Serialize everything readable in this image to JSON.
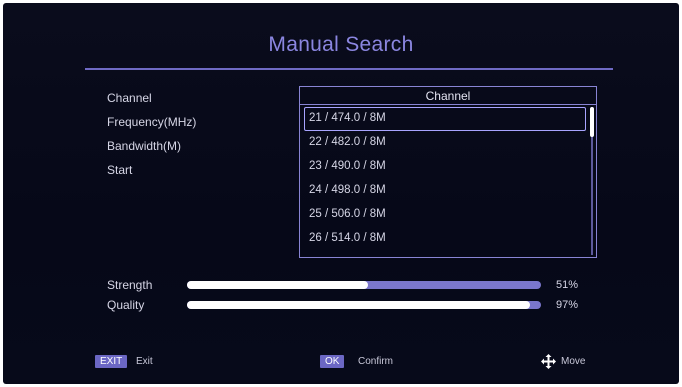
{
  "title": "Manual Search",
  "fields": {
    "channel_label": "Channel",
    "frequency_label": "Frequency(MHz)",
    "bandwidth_label": "Bandwidth(M)",
    "start_label": "Start"
  },
  "channel_list": {
    "header": "Channel",
    "items": [
      "21 / 474.0 / 8M",
      "22 / 482.0 / 8M",
      "23 / 490.0 / 8M",
      "24 / 498.0 / 8M",
      "25 / 506.0 / 8M",
      "26 / 514.0 / 8M"
    ],
    "selected_index": 0
  },
  "signal": {
    "strength_label": "Strength",
    "strength_value": "51%",
    "strength_fraction": 0.51,
    "quality_label": "Quality",
    "quality_value": "97%",
    "quality_fraction": 0.97
  },
  "footer": {
    "exit_key": "EXIT",
    "exit_label": "Exit",
    "ok_key": "OK",
    "ok_label": "Confirm",
    "move_icon": "move-arrows-icon",
    "move_label": "Move"
  },
  "colors": {
    "accent": "#8b86e0",
    "bar_track": "#7a76cc",
    "bar_fill": "#ffffff",
    "selection_border": "#a8a4ff"
  }
}
